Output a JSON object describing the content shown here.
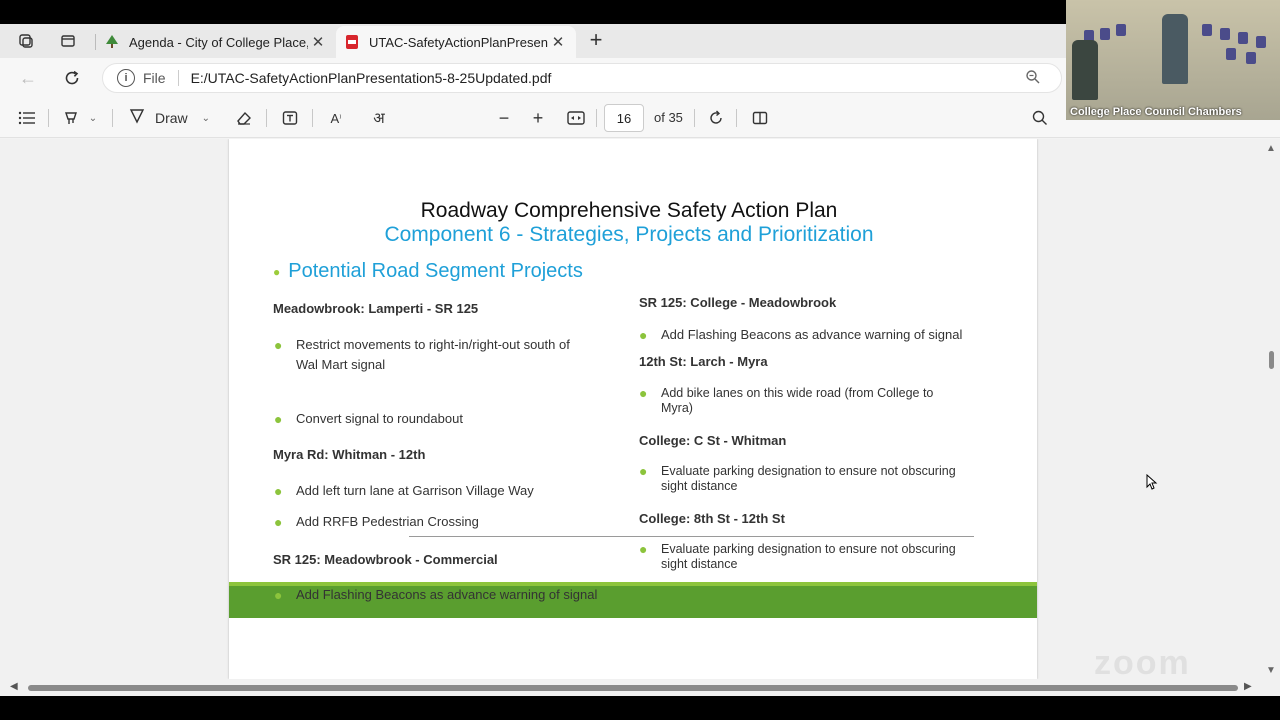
{
  "tabs": [
    {
      "title": "Agenda - City of College Place, W",
      "favicon": "tree-favicon"
    },
    {
      "title": "UTAC-SafetyActionPlanPresentatio",
      "favicon": "pdf-favicon"
    }
  ],
  "address": {
    "scheme_label": "File",
    "url": "E:/UTAC-SafetyActionPlanPresentation5-8-25Updated.pdf"
  },
  "pdf_toolbar": {
    "draw_label": "Draw",
    "page_number": "16",
    "page_count": "of 35"
  },
  "slide": {
    "title": "Roadway Comprehensive Safety Action Plan",
    "subtitle": "Component 6 - Strategies, Projects and Prioritization",
    "section_heading": "Potential Road Segment Projects",
    "left": {
      "h1": "Meadowbrook:  Lamperti - SR 125",
      "b1a": "Restrict movements to right-in/right-out south of",
      "b1b": "Wal Mart signal",
      "b2": "Convert signal to roundabout",
      "h2": "Myra Rd: Whitman - 12th",
      "b3": "Add left turn lane at Garrison Village Way",
      "b4": "Add RRFB Pedestrian Crossing",
      "h3": "SR 125:  Meadowbrook - Commercial",
      "b5": "Add Flashing Beacons as advance warning of signal"
    },
    "right": {
      "h1": "SR 125:  College - Meadowbrook",
      "b1": "Add Flashing Beacons as advance warning of signal",
      "h2": "12th St:  Larch - Myra",
      "b2a": "Add bike lanes on this wide road  (from College to",
      "b2b": "Myra)",
      "h3": "College:  C St - Whitman",
      "b3a": "Evaluate parking designation to ensure not obscuring",
      "b3b": "sight distance",
      "h4": "College:  8th St - 12th St",
      "b4a": "Evaluate parking designation to ensure not obscuring",
      "b4b": "sight distance"
    }
  },
  "video": {
    "label": "College Place Council Chambers"
  },
  "watermark": "zoom",
  "colors": {
    "accent_blue": "#1fa0d8",
    "bullet_green": "#8cc43c",
    "bar_green": "#5a9e2f"
  }
}
